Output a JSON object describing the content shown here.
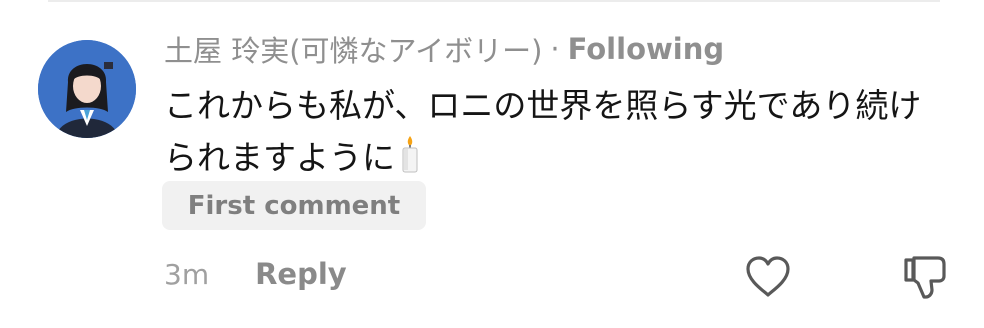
{
  "comment": {
    "author": "土屋 玲実(可憐なアイボリー)",
    "separator": "·",
    "following_label": "Following",
    "text": "これからも私が、ロニの世界を照らす光であり続けられますように",
    "emoji": "candle",
    "badge": "First comment",
    "time": "3m",
    "reply_label": "Reply"
  },
  "icons": {
    "avatar": "avatar",
    "candle": "candle-icon",
    "like": "heart-icon",
    "dislike": "thumbs-down-icon"
  },
  "colors": {
    "avatar_bg": "#3d72c6",
    "text_primary": "#151515",
    "text_muted": "#8f8f8f"
  }
}
